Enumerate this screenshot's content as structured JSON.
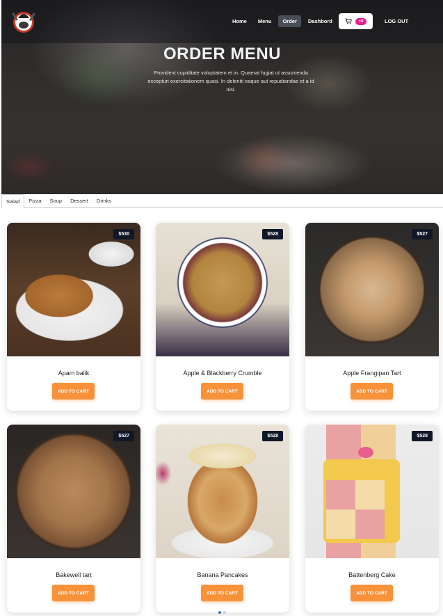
{
  "navbar": {
    "links": [
      "Home",
      "Menu",
      "Order",
      "Dashbord"
    ],
    "active_link": "Order",
    "cart_count": "+0",
    "logout_label": "LOG OUT"
  },
  "hero": {
    "title": "ORDER MENU",
    "subtitle": "Provident cupiditate voluptatem et in. Quaerat fugiat ut assumenda excepturi exercitationem quasi. In deleniti eaque aut repudiandae et a id nisi."
  },
  "tabs": {
    "items": [
      "Salad",
      "Pizza",
      "Soup",
      "Dessert",
      "Drinks"
    ],
    "active": "Salad"
  },
  "products": [
    {
      "name": "Apam balik",
      "price": "$530",
      "button": "ADD TO CART"
    },
    {
      "name": "Apple & Blackberry Crumble",
      "price": "$528",
      "button": "ADD TO CART"
    },
    {
      "name": "Apple Frangipan Tart",
      "price": "$527",
      "button": "ADD TO CART"
    },
    {
      "name": "Bakewell tart",
      "price": "$527",
      "button": "ADD TO CART"
    },
    {
      "name": "Banana Pancakes",
      "price": "$528",
      "button": "ADD TO CART"
    },
    {
      "name": "Battenberg Cake",
      "price": "$528",
      "button": "ADD TO CART"
    }
  ],
  "colors": {
    "accent": "#f7923a",
    "price_tag": "#101828",
    "cart_badge": "#e91e8c"
  },
  "icons": {
    "logo": "chef-logo-icon",
    "cart": "shopping-cart-icon"
  }
}
